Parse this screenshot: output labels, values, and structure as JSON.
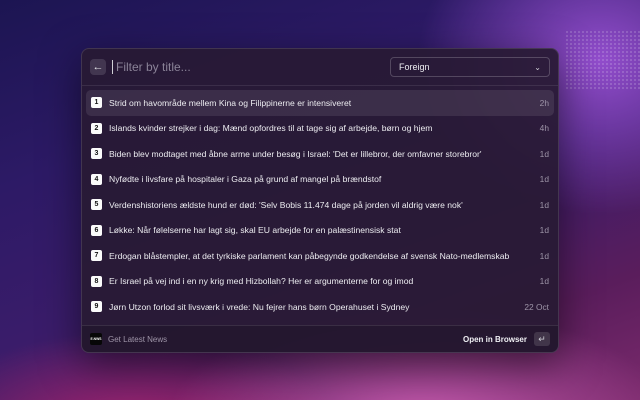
{
  "search": {
    "placeholder": "Filter by title..."
  },
  "filter": {
    "selected": "Foreign"
  },
  "items": [
    {
      "index": "1",
      "title": "Strid om havområde mellem Kina og Filippinerne er intensiveret",
      "time": "2h"
    },
    {
      "index": "2",
      "title": "Islands kvinder strejker i dag: Mænd opfordres til at tage sig af arbejde, børn og hjem",
      "time": "4h"
    },
    {
      "index": "3",
      "title": "Biden blev modtaget med åbne arme under besøg i Israel: 'Det er lillebror, der omfavner storebror'",
      "time": "1d"
    },
    {
      "index": "4",
      "title": "Nyfødte i livsfare på hospitaler i Gaza på grund af mangel på brændstof",
      "time": "1d"
    },
    {
      "index": "5",
      "title": "Verdenshistoriens ældste hund er død: 'Selv Bobis 11.474 dage på jorden vil aldrig være nok'",
      "time": "1d"
    },
    {
      "index": "6",
      "title": "Løkke: Når følelserne har lagt sig, skal EU arbejde for en palæstinensisk stat",
      "time": "1d"
    },
    {
      "index": "7",
      "title": "Erdogan blåstempler, at det tyrkiske parlament kan påbegynde godkendelse af svensk Nato-medlemskab",
      "time": "1d"
    },
    {
      "index": "8",
      "title": "Er Israel på vej ind i en ny krig med Hizbollah? Her er argumenterne for og imod",
      "time": "1d"
    },
    {
      "index": "9",
      "title": "Jørn Utzon forlod sit livsværk i vrede: Nu fejrer hans børn Operahuset i Sydney",
      "time": "22 Oct"
    }
  ],
  "footer": {
    "logo_text": "E.NWS",
    "command": "Get Latest News",
    "action": "Open in Browser"
  },
  "icons": {
    "back": "arrow-left-icon",
    "dropdown": "chevron-down-icon",
    "enter": "return-key-icon"
  }
}
